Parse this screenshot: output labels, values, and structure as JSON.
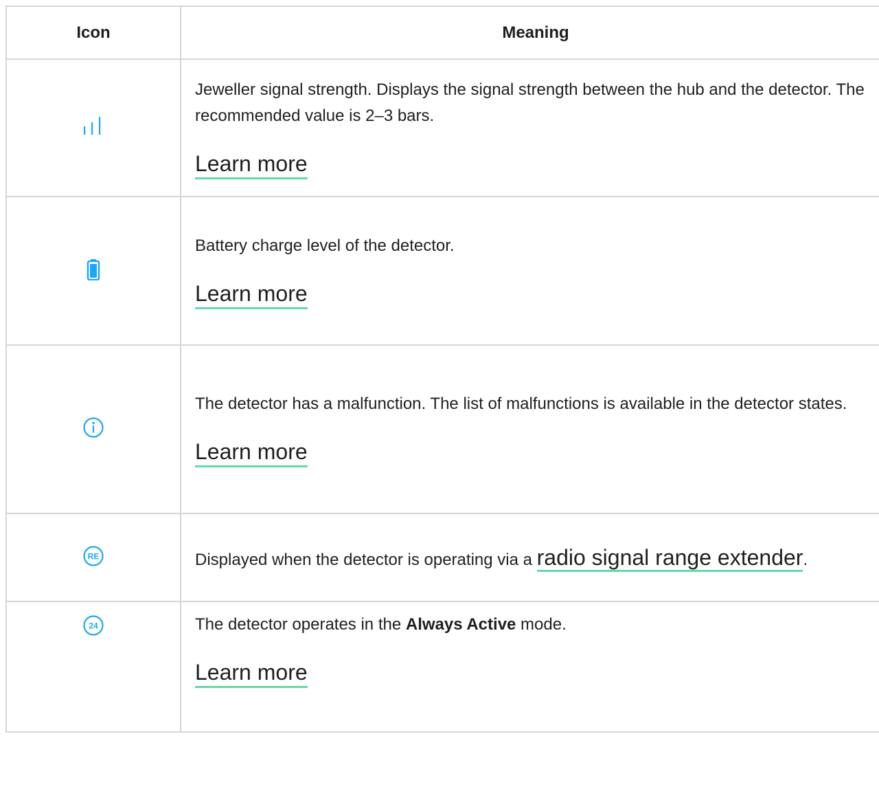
{
  "headers": {
    "icon": "Icon",
    "meaning": "Meaning"
  },
  "rows": [
    {
      "icon": "signal-strength-icon",
      "text": "Jeweller signal strength. Displays the signal strength between the hub and the detector. The recommended value is 2–3 bars.",
      "link": "Learn more"
    },
    {
      "icon": "battery-icon",
      "text": "Battery charge level of the detector.",
      "link": "Learn more"
    },
    {
      "icon": "info-icon",
      "text": "The detector has a malfunction. The list of malfunctions is available in the detector states.",
      "link": "Learn more"
    },
    {
      "icon": "range-extender-icon",
      "icon_text": "RE",
      "text_before": "Displayed when the detector is operating via a ",
      "inline_link": "radio signal range extender",
      "text_after": "."
    },
    {
      "icon": "always-active-icon",
      "icon_text": "24",
      "text_before": "The detector operates in the ",
      "bold": "Always Active",
      "text_after": " mode.",
      "link": "Learn more"
    }
  ],
  "colors": {
    "accent_icon": "#1ea7f0",
    "link_underline": "#5fdba6",
    "border": "#d6d6d6"
  }
}
